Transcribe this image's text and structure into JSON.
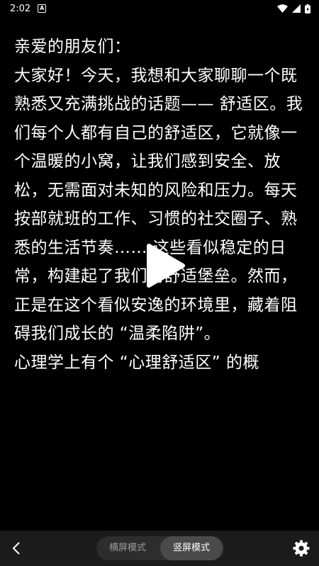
{
  "status_bar": {
    "time": "2:02",
    "notification_icon_label": "A",
    "icons": [
      "wifi-icon",
      "signal-icon",
      "battery-icon"
    ]
  },
  "reader": {
    "paragraphs": [
      "亲爱的朋友们：",
      "大家好！今天，我想和大家聊聊一个既熟悉又充满挑战的话题—— 舒适区。我们每个人都有自己的舒适区，它就像一个温暖的小窝，让我们感到安全、放松，无需面对未知的风险和压力。每天按部就班的工作、习惯的社交圈子、熟悉的生活节奏…… 这些看似稳定的日常，构建起了我们的舒适堡垒。然而，正是在这个看似安逸的环境里，藏着阻碍我们成长的 “温柔陷阱”。",
      "心理学上有个 “心理舒适区” 的概"
    ]
  },
  "bottom_bar": {
    "landscape_label": "横屏模式",
    "portrait_label": "竖屏模式",
    "active_mode": "portrait"
  }
}
